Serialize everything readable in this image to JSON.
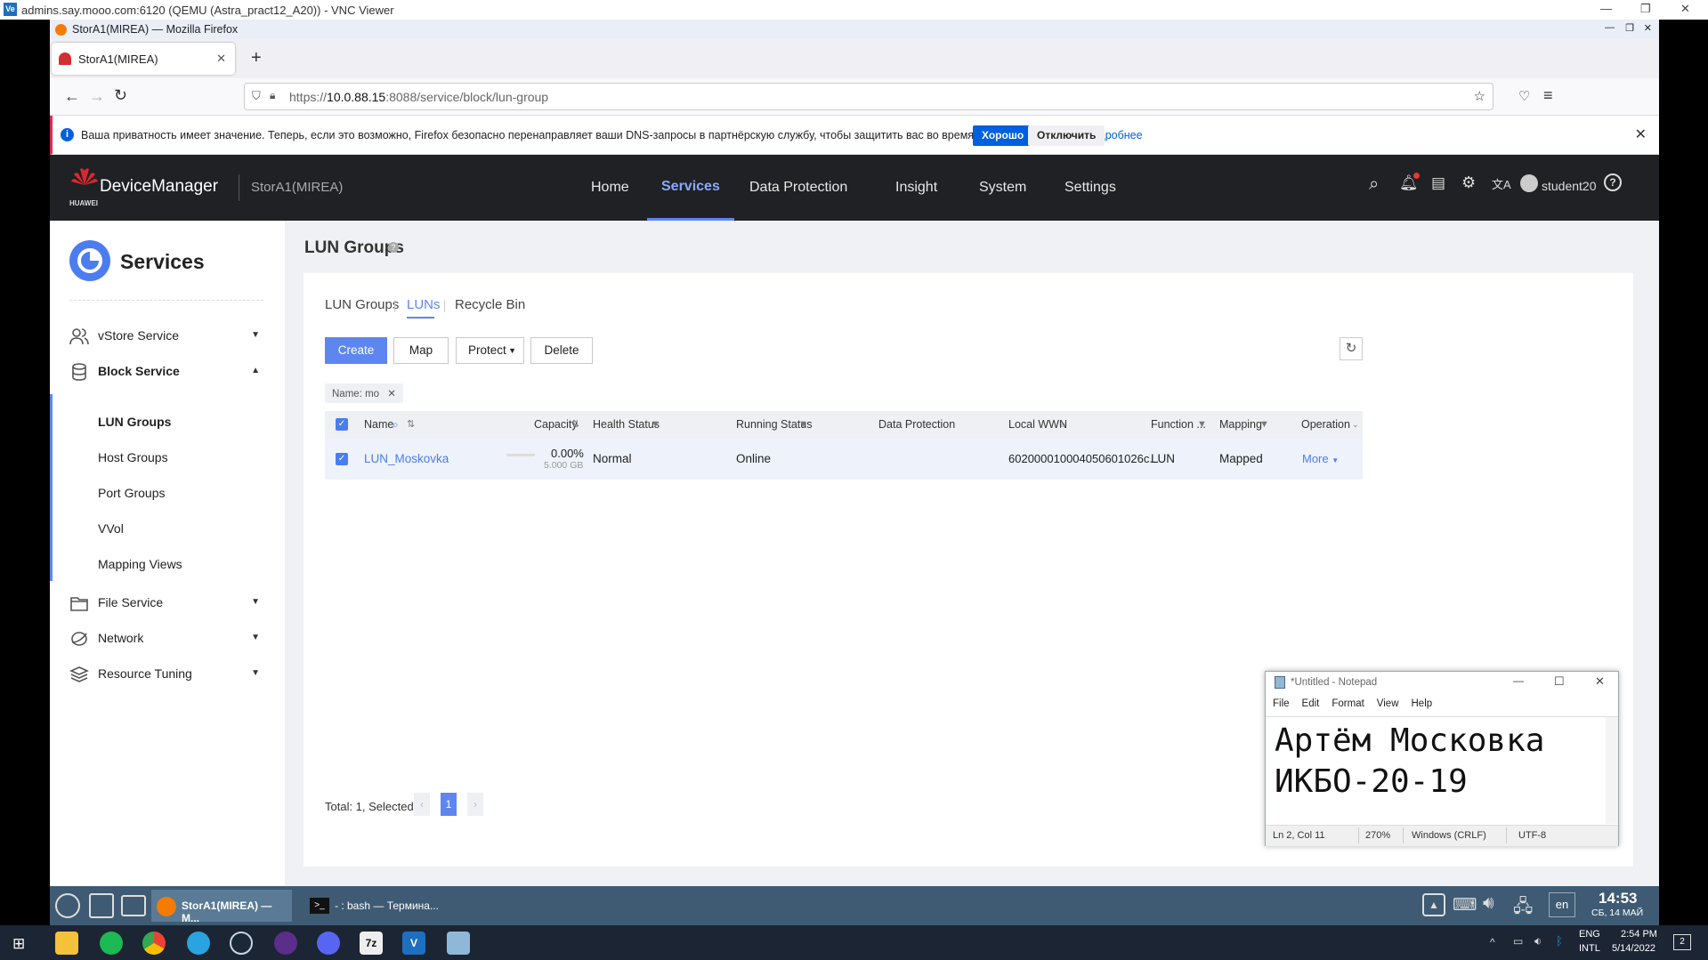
{
  "vnc": {
    "title": "admins.say.mooo.com:6120 (QEMU (Astra_pract12_A20)) - VNC Viewer",
    "icon_text": "Ve"
  },
  "firefox": {
    "title": "StorA1(MIREA) — Mozilla Firefox",
    "tab_label": "StorA1(MIREA)",
    "url_prefix": "https://",
    "url_host": "10.0.88.15",
    "url_rest": ":8088/service/block/lun-group",
    "notice_text": "Ваша приватность имеет значение. Теперь, если это возможно, Firefox безопасно перенаправляет ваши DNS-запросы в партнёрскую службу, чтобы защитить вас во время Интернет-сёрфинга.",
    "notice_link": "Подробнее",
    "notice_ok": "Хорошо",
    "notice_disable": "Отключить"
  },
  "app": {
    "brand": "DeviceManager",
    "huawei": "HUAWEI",
    "device": "StorA1(MIREA)",
    "menu": [
      "Home",
      "Services",
      "Data Protection",
      "Insight",
      "System",
      "Settings"
    ],
    "user": "student20"
  },
  "sidebar": {
    "title": "Services",
    "items": [
      {
        "label": "vStore Service",
        "icon": "users-icon"
      },
      {
        "label": "Block Service",
        "icon": "database-icon"
      },
      {
        "label": "File Service",
        "icon": "folder-icon"
      },
      {
        "label": "Network",
        "icon": "network-icon"
      },
      {
        "label": "Resource Tuning",
        "icon": "layers-icon"
      }
    ],
    "sub": [
      "LUN Groups",
      "Host Groups",
      "Port Groups",
      "VVol",
      "Mapping Views"
    ]
  },
  "page": {
    "title": "LUN Groups",
    "tabs": [
      "LUN Groups",
      "LUNs",
      "Recycle Bin"
    ],
    "buttons": {
      "create": "Create",
      "map": "Map",
      "protect": "Protect",
      "delete": "Delete"
    },
    "filter_chip": "Name: mo",
    "columns": [
      "Name",
      "Capacity",
      "Health Status",
      "Running Status",
      "Data Protection",
      "Local WWN",
      "Function ...",
      "Mapping",
      "Operation"
    ],
    "rows": [
      {
        "name": "LUN_Moskovka",
        "capacity_pct": "0.00%",
        "capacity": "5.000 GB",
        "health": "Normal",
        "running": "Online",
        "protection": "",
        "wwn": "602000010004050601026c...",
        "function": "LUN",
        "mapping": "Mapped",
        "operation": "More"
      }
    ],
    "total_text": "Total: 1, Selected: 1",
    "page_number": "1"
  },
  "notepad": {
    "title": "*Untitled - Notepad",
    "menu": [
      "File",
      "Edit",
      "Format",
      "View",
      "Help"
    ],
    "line1": "Артём Московка",
    "line2": "ИКБО-20-19",
    "status": {
      "pos": "Ln 2, Col 11",
      "zoom": "270%",
      "eol": "Windows (CRLF)",
      "enc": "UTF-8"
    }
  },
  "guest_taskbar": {
    "firefox_task": "StorA1(MIREA) — M...",
    "terminal_task": "- : bash — Термина...",
    "clock_time": "14:53",
    "clock_date": "СБ, 14 МАЙ",
    "lang": "en"
  },
  "windows_taskbar": {
    "lang1": "ENG",
    "lang2": "INTL",
    "time": "2:54 PM",
    "date": "5/14/2022",
    "notif_count": "2"
  },
  "colors": {
    "accent": "#5e86f0",
    "header_bg": "#202124",
    "guest_bar": "#3e5b73"
  }
}
